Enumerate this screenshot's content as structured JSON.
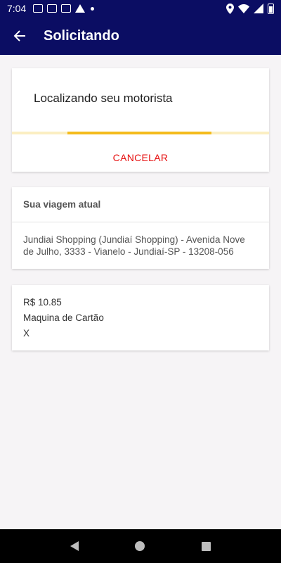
{
  "status_bar": {
    "time": "7:04",
    "icons": [
      "notification-icon",
      "notification-icon",
      "gmail-icon",
      "drive-icon",
      "dot-icon",
      "location-icon",
      "wifi-icon",
      "signal-icon",
      "battery-icon"
    ]
  },
  "app_bar": {
    "title": "Solicitando",
    "back_icon": "arrow-left-icon"
  },
  "search_card": {
    "title": "Localizando seu motorista",
    "progress": 0.56,
    "cancel_label": "CANCELAR"
  },
  "trip_card": {
    "header": "Sua viagem atual",
    "address": "Jundiai Shopping (Jundiaí Shopping) - Avenida Nove de Julho, 3333 - Vianelo - Jundiaí-SP - 13208-056"
  },
  "payment_card": {
    "price": "R$ 10.85",
    "method": "Maquina de Cartão",
    "extra": "X"
  },
  "colors": {
    "primary": "#0b0d63",
    "accent_progress": "#f4bb1c",
    "cancel": "#e60e0e",
    "background": "#f6f4f6"
  }
}
